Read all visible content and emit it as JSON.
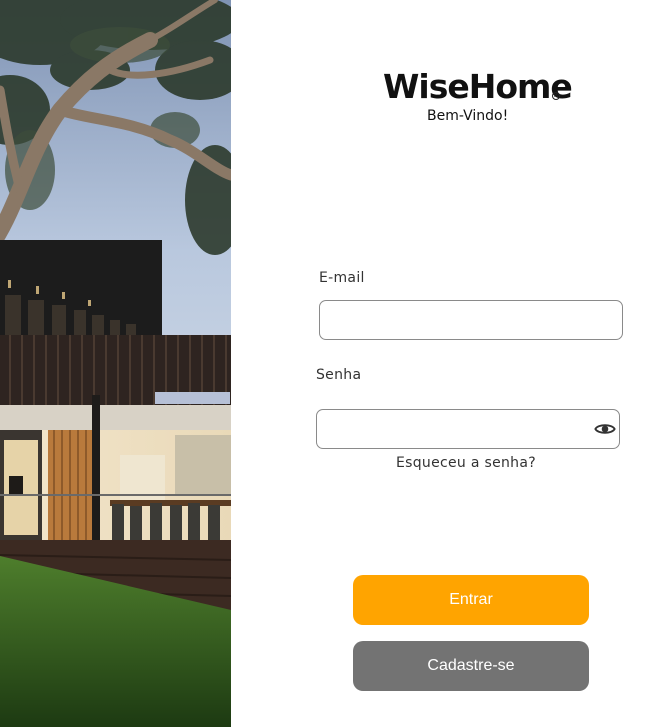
{
  "brand": {
    "name": "WiseHome",
    "registered_mark": "R",
    "welcome": "Bem-Vindo!"
  },
  "form": {
    "email_label": "E-mail",
    "email_value": "",
    "password_label": "Senha",
    "password_value": "",
    "show_password_icon": "eye-icon",
    "forgot_password": "Esqueceu a senha?"
  },
  "buttons": {
    "login_label": "Entrar",
    "signup_label": "Cadastre-se"
  },
  "colors": {
    "login_button": "#FFA400",
    "signup_button": "#737373",
    "field_border": "#8a8a8a"
  }
}
